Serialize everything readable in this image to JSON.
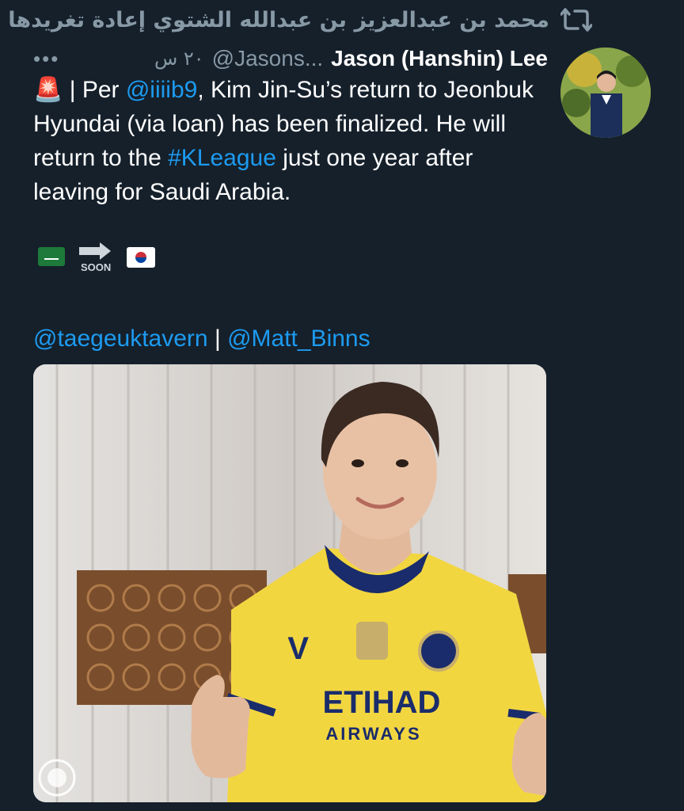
{
  "retweet": {
    "text": "محمد بن عبدالعزيز بن عبدالله الشتوي إعادة تغريدها",
    "icon": "retweet-icon"
  },
  "tweet": {
    "display_name": "Jason (Hanshin) Lee",
    "handle": "@Jasons...",
    "time": "٢٠ س",
    "more": "•••",
    "text": {
      "siren": "🚨",
      "part1": " | Per ",
      "mention1": "@iiiib9",
      "part2": ", Kim Jin-Su’s return to Jeonbuk Hyundai (via loan) has been finalized. He will return to the ",
      "hashtag": "#KLeague",
      "part3": " just one year after leaving for Saudi Arabia."
    },
    "emoji_row": {
      "soon_label": "SOON"
    },
    "mentions": [
      "@taegeuktavern",
      "@Matt_Binns"
    ],
    "mentions_separator": "|"
  },
  "media": {
    "jersey_sponsor_line1": "ETIHAD",
    "jersey_sponsor_line2": "AIRWAYS",
    "jersey_brand": "V"
  },
  "colors": {
    "background": "#15202b",
    "link": "#1d9bf0",
    "muted": "#8899a6",
    "jersey": "#f2d640",
    "jersey_trim": "#1a2c6b"
  }
}
